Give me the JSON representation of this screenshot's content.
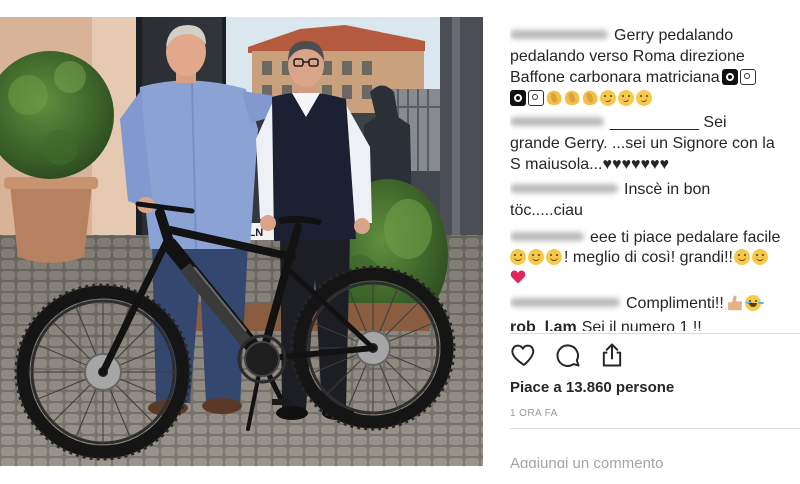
{
  "photo": {
    "sign_text": "COLN"
  },
  "comments": [
    {
      "lines": [
        {
          "text": "Gerry pedalando"
        },
        {
          "text": "pedalando verso Roma direzione"
        },
        {
          "text": "Baffone carbonara matriciana",
          "emojis_after": [
            "o-button",
            "camera"
          ]
        },
        {
          "emojis": [
            "o-button",
            "camera",
            "clap",
            "clap",
            "clap",
            "smirk",
            "smirk",
            "smirk"
          ]
        }
      ]
    },
    {
      "lines": [
        {
          "text": "__________ Sei"
        },
        {
          "text": "grande Gerry. ...sei un Signore con la"
        },
        {
          "text": "S maiusola...♥♥♥♥♥♥♥"
        }
      ]
    },
    {
      "lines": [
        {
          "text": "Inscè in bon"
        },
        {
          "text": "töc.....ciau"
        }
      ]
    },
    {
      "lines": [
        {
          "text": "eee ti piace pedalare facile"
        },
        {
          "emojis_before": [
            "smile",
            "smile",
            "smile"
          ],
          "text": "! meglio di così! grandi!!",
          "emojis_after": [
            "smile",
            "smile"
          ]
        },
        {
          "emojis": [
            "heart"
          ]
        }
      ]
    },
    {
      "lines": [
        {
          "text": "Complimenti!!",
          "emojis_after": [
            "thumbs-up",
            "laugh"
          ]
        }
      ]
    },
    {
      "lines": [
        {
          "username": "rob_l.am",
          "text": "Sei il numero 1 !!"
        }
      ]
    }
  ],
  "actions": {
    "like_icon": "heart-outline-icon",
    "comment_icon": "speech-bubble-icon",
    "share_icon": "share-arrow-icon"
  },
  "likes_text": "Piace a 13.860 persone",
  "time_text": "1 ORA FA",
  "add_comment_placeholder": "Aggiungi un commento",
  "colors": {
    "text": "#262626",
    "muted": "#999999",
    "divider": "#dbdbdb",
    "heart_emoji": "#e0245e"
  }
}
